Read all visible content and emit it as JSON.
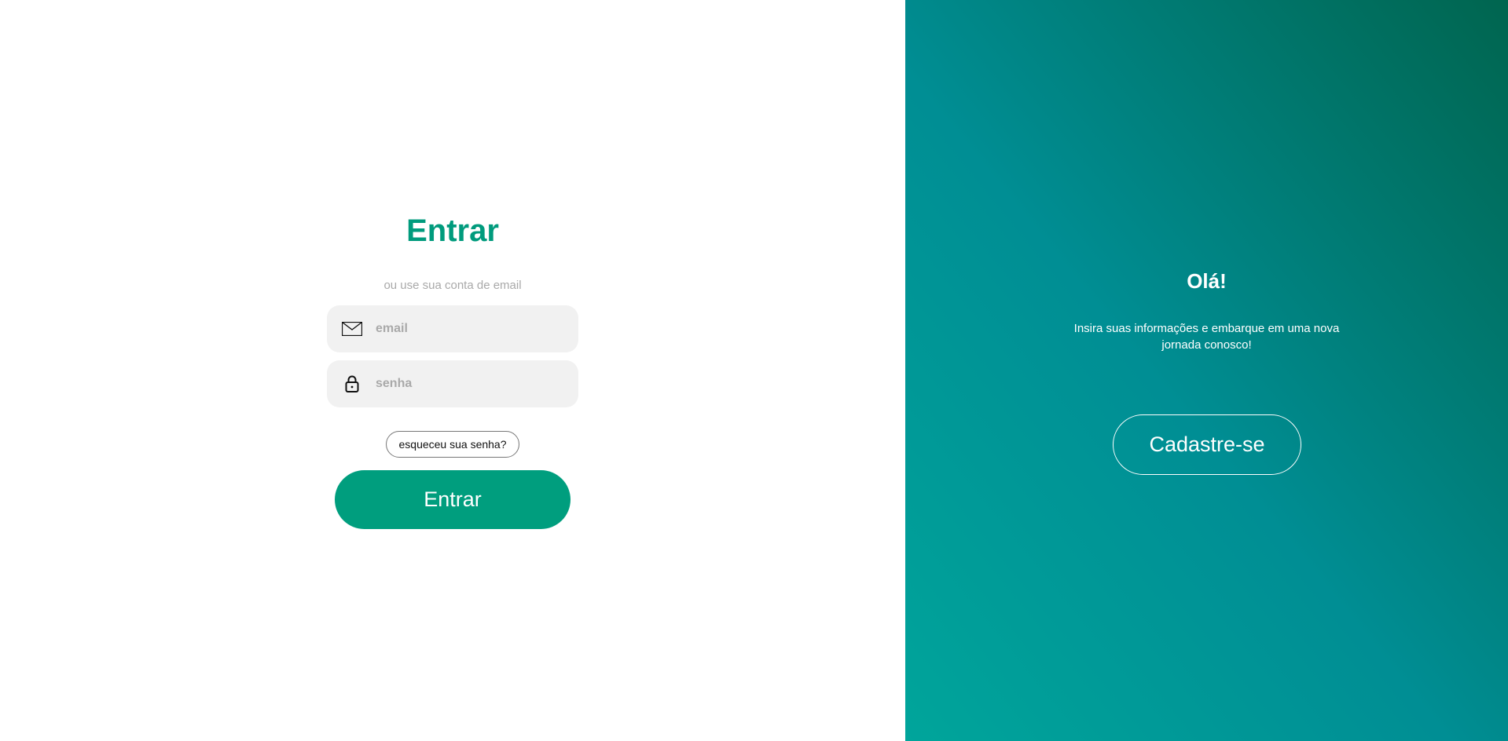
{
  "login": {
    "title": "Entrar",
    "subtitle": "ou use sua conta de email",
    "email_placeholder": "email",
    "password_placeholder": "senha",
    "forgot_label": "esqueceu sua senha?",
    "submit_label": "Entrar",
    "accent": "#009e7e"
  },
  "signup_panel": {
    "greeting": "Olá!",
    "description": "Insira suas informações e embarque em uma nova jornada conosco!",
    "button_label": "Cadastre-se",
    "gradient": [
      "#00a59b",
      "#008e94",
      "#00654f"
    ]
  }
}
